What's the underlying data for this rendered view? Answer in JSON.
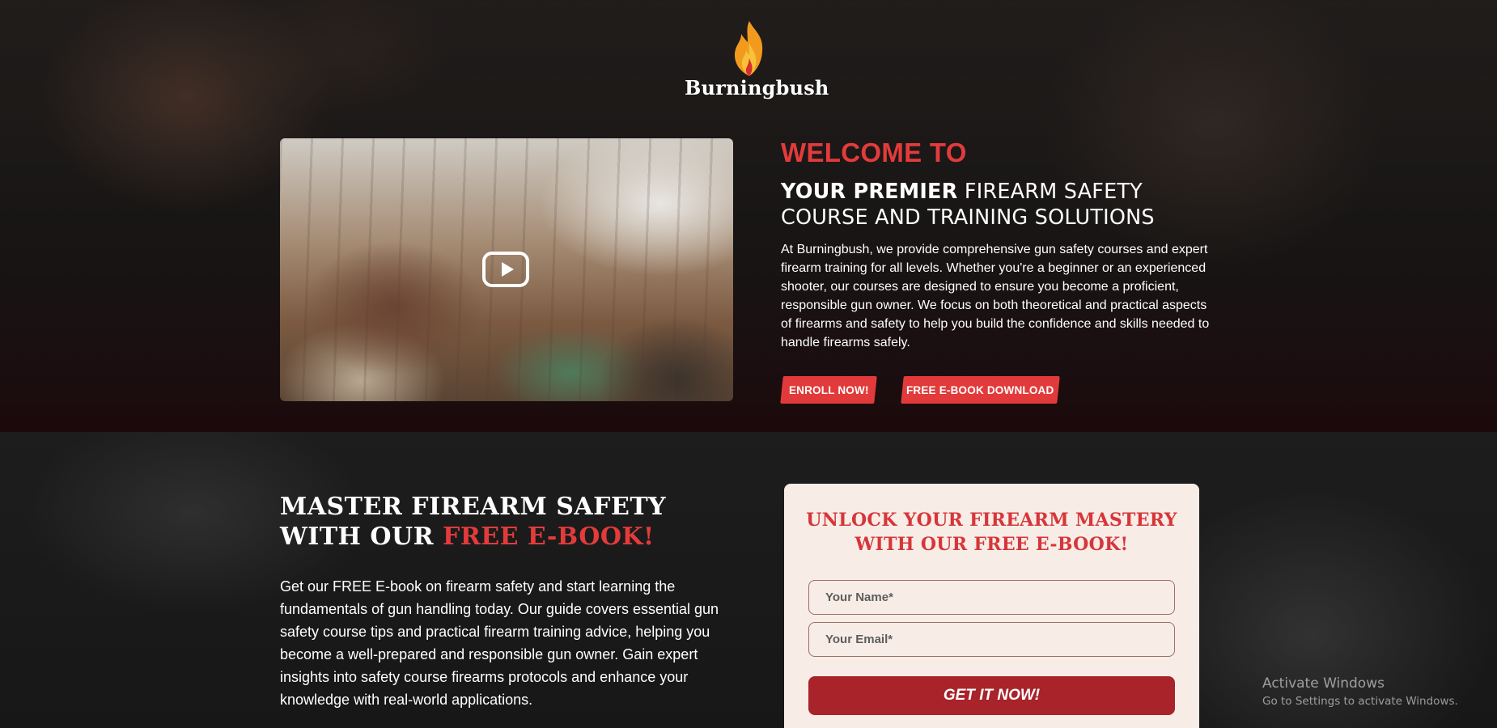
{
  "brand": {
    "name": "Burningbush",
    "flame_color": "#f29a1e",
    "flame_inner_color": "#d62e2e"
  },
  "hero": {
    "welcome": "WELCOME TO",
    "headline_strong": "YOUR PREMIER",
    "headline_rest": " FIREARM SAFETY COURSE AND TRAINING SOLUTIONS",
    "description": "At Burningbush, we provide comprehensive gun safety courses and expert firearm training for all levels. Whether you're a beginner or an experienced shooter, our courses are designed to ensure you become a proficient, responsible gun owner. We focus on both theoretical and practical aspects of firearms and safety to help you build the confidence and skills needed to handle firearms safely.",
    "buttons": {
      "enroll": "ENROLL NOW!",
      "ebook": "FREE E-BOOK DOWNLOAD"
    },
    "video": {
      "play_icon": "play-icon"
    }
  },
  "ebook_section": {
    "title_part1": "MASTER FIREARM SAFETY WITH OUR ",
    "title_accent": "FREE E-BOOK!",
    "description": "Get our FREE E-book on firearm safety and start learning the fundamentals of gun handling today. Our guide covers essential gun safety course tips and practical firearm training advice, helping you become a well-prepared and responsible gun owner. Gain expert insights into safety course firearms protocols and enhance your knowledge with real-world applications."
  },
  "form": {
    "title": "UNLOCK YOUR FIREARM MASTERY WITH OUR FREE E-BOOK!",
    "name_placeholder": "Your Name*",
    "email_placeholder": "Your Email*",
    "submit": "GET IT NOW!"
  },
  "os_overlay": {
    "line1": "Activate Windows",
    "line2": "Go to Settings to activate Windows."
  },
  "colors": {
    "accent_red": "#e23a3a",
    "form_button": "#a8232a",
    "form_bg": "#f8ece6"
  }
}
